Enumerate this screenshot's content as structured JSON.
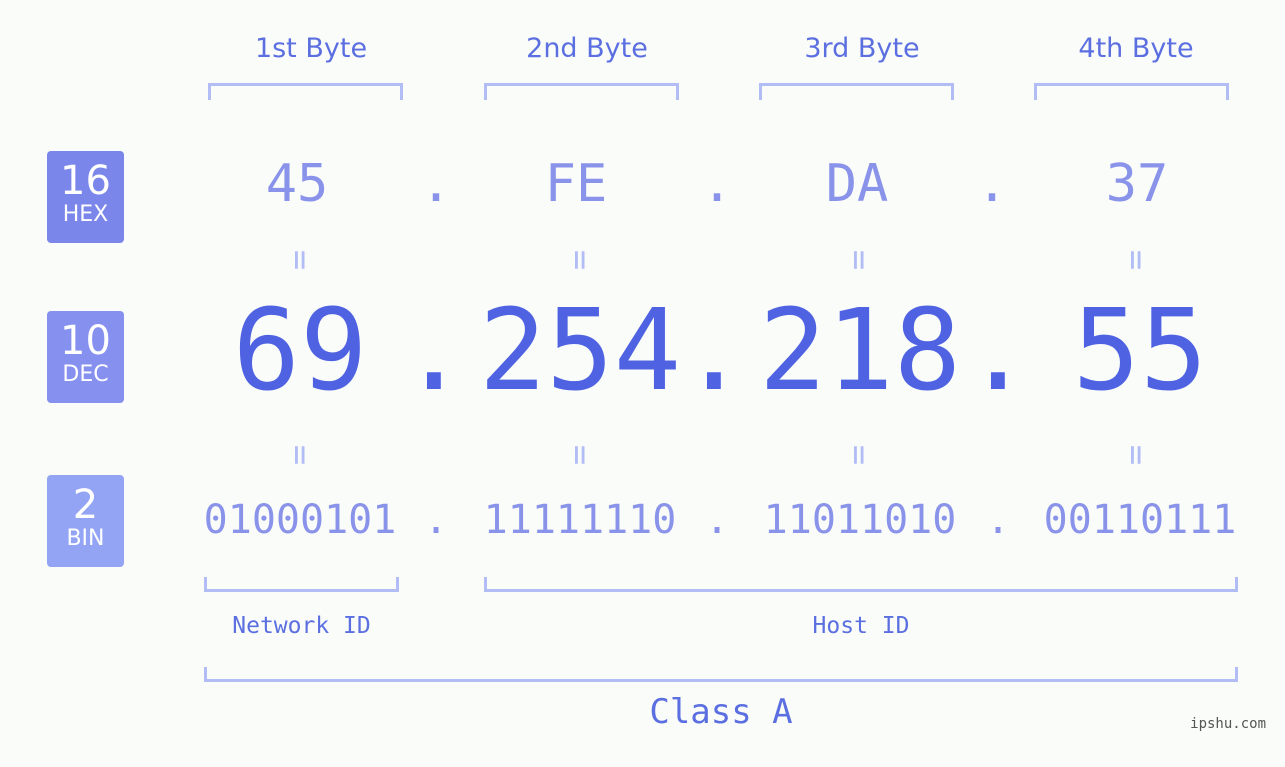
{
  "header": {
    "bytes": [
      "1st Byte",
      "2nd Byte",
      "3rd Byte",
      "4th Byte"
    ]
  },
  "rows": {
    "hex": {
      "base": "16",
      "label": "HEX",
      "color": "#7b86ea",
      "values": [
        "45",
        "FE",
        "DA",
        "37"
      ]
    },
    "dec": {
      "base": "10",
      "label": "DEC",
      "color": "#8690ee",
      "values": [
        "69",
        "254",
        "218",
        "55"
      ]
    },
    "bin": {
      "base": "2",
      "label": "BIN",
      "color": "#93a4f5",
      "values": [
        "01000101",
        "11111110",
        "11011010",
        "00110111"
      ]
    }
  },
  "separator": ".",
  "equals": "=",
  "ids": {
    "network": "Network ID",
    "host": "Host ID",
    "class": "Class A"
  },
  "watermark": "ipshu.com"
}
